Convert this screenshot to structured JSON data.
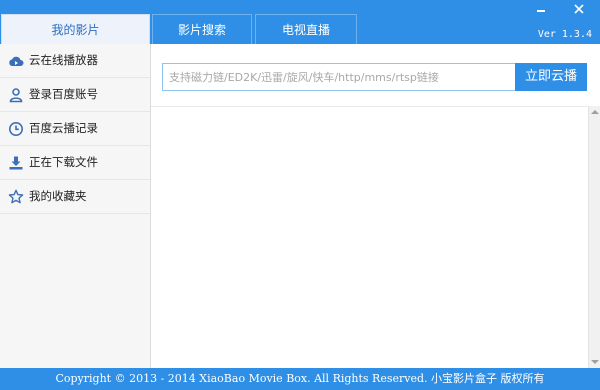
{
  "tabs": [
    {
      "label": "我的影片",
      "active": true
    },
    {
      "label": "影片搜索",
      "active": false
    },
    {
      "label": "电视直播",
      "active": false
    }
  ],
  "window": {
    "version": "Ver 1.3.4"
  },
  "sidebar": {
    "items": [
      {
        "label": "云在线播放器",
        "icon": "cloud-play-icon"
      },
      {
        "label": "登录百度账号",
        "icon": "user-icon"
      },
      {
        "label": "百度云播记录",
        "icon": "clock-icon"
      },
      {
        "label": "正在下载文件",
        "icon": "download-icon"
      },
      {
        "label": "我的收藏夹",
        "icon": "star-icon"
      }
    ]
  },
  "main": {
    "url_placeholder": "支持磁力链/ED2K/迅雷/旋风/快车/http/mms/rtsp链接",
    "url_value": "",
    "cloud_button": "立即云播"
  },
  "footer": {
    "copyright": "Copyright © 2013 - 2014 XiaoBao Movie Box. All Rights Reserved. 小宝影片盒子 版权所有"
  },
  "colors": {
    "accent": "#2f8fe6",
    "icon": "#3d6fb6"
  }
}
